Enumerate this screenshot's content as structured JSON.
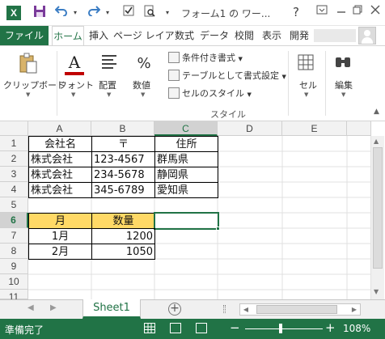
{
  "window": {
    "title": "フォーム1 の ワー...",
    "app_icon": "X",
    "help": "?",
    "controls": [
      "minimize-icon",
      "restore-icon",
      "close-icon"
    ]
  },
  "tabs": {
    "file": "ファイル",
    "items": [
      "ホーム",
      "挿入",
      "ページ レイア",
      "数式",
      "データ",
      "校閲",
      "表示",
      "開発"
    ],
    "active": "ホーム"
  },
  "ribbon": {
    "clipboard": "クリップボード",
    "font": "フォント",
    "align": "配置",
    "number": "数値",
    "number_symbol": "%",
    "font_symbol": "A",
    "conditional_format": "条件付き書式",
    "format_as_table": "テーブルとして書式設定",
    "cell_styles": "セルのスタイル",
    "styles_group": "スタイル",
    "cells": "セル",
    "editing": "編集"
  },
  "grid": {
    "columns": [
      "A",
      "B",
      "C",
      "D",
      "E"
    ],
    "selected_column": "C",
    "rows": [
      "1",
      "2",
      "3",
      "4",
      "5",
      "6",
      "7",
      "8",
      "9",
      "10",
      "11"
    ],
    "selected_row": "6",
    "table1": {
      "headers": [
        "会社名",
        "〒",
        "住所"
      ],
      "rows": [
        [
          "株式会社",
          "123-4567",
          "群馬県"
        ],
        [
          "株式会社",
          "234-5678",
          "静岡県"
        ],
        [
          "株式会社",
          "345-6789",
          "愛知県"
        ]
      ]
    },
    "table2": {
      "headers": [
        "月",
        "数量"
      ],
      "rows": [
        [
          "1月",
          "1200"
        ],
        [
          "2月",
          "1050"
        ]
      ]
    },
    "header_fill": "#ffd966",
    "accent": "#217346"
  },
  "sheets": {
    "active": "Sheet1",
    "add": "+"
  },
  "status": {
    "text": "準備完了",
    "zoom": "108%"
  }
}
